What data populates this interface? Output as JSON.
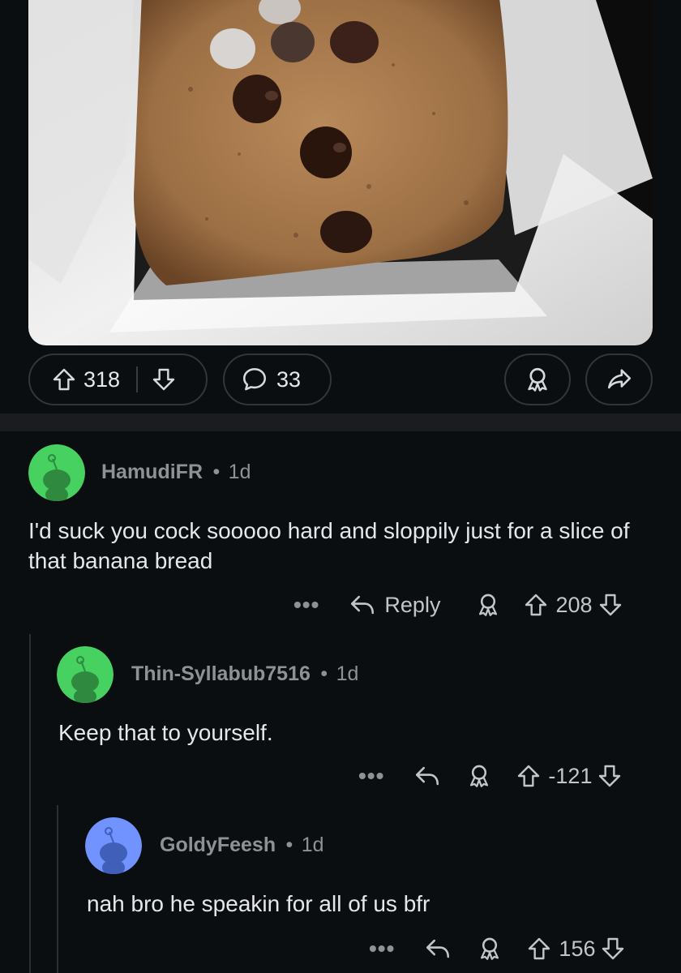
{
  "post": {
    "image_alt": "banana bread loaf with chocolate chips in parchment paper",
    "upvotes": "318",
    "comments": "33"
  },
  "comments": [
    {
      "username": "HamudiFR",
      "separator": "•",
      "age": "1d",
      "text": "I'd suck you cock sooooo hard and sloppily just for a slice of that banana bread",
      "reply_label": "Reply",
      "more": "•••",
      "score": "208",
      "avatar_color": "#46d160"
    },
    {
      "username": "Thin-Syllabub7516",
      "separator": "•",
      "age": "1d",
      "text": "Keep that to yourself.",
      "more": "•••",
      "score": "-121",
      "avatar_color": "#46d160"
    },
    {
      "username": "GoldyFeesh",
      "separator": "•",
      "age": "1d",
      "text": "nah bro he speakin for all of us bfr",
      "more": "•••",
      "score": "156",
      "avatar_color": "#7193ff"
    }
  ],
  "icons": {
    "upvote": "upvote-arrow-icon",
    "downvote": "downvote-arrow-icon",
    "comment": "comment-bubble-icon",
    "award": "award-icon",
    "share": "share-icon",
    "reply": "reply-arrow-icon"
  }
}
